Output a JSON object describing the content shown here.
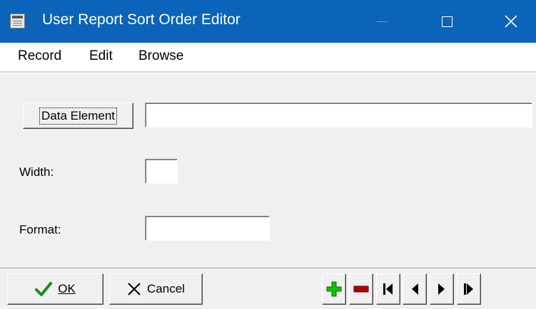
{
  "window": {
    "title": "User Report Sort Order Editor",
    "icons": {
      "app": "report-app-icon",
      "minimize": "minimize-icon",
      "maximize": "maximize-icon",
      "close": "close-icon"
    }
  },
  "menu": {
    "items": [
      "Record",
      "Edit",
      "Browse"
    ]
  },
  "form": {
    "data_element_button": "Data Element",
    "data_element_value": "",
    "width_label": "Width:",
    "width_value": "",
    "format_label": "Format:",
    "format_value": ""
  },
  "footer": {
    "ok_label": "OK",
    "cancel_label": "Cancel",
    "nav_icons": [
      "add-record-icon",
      "delete-record-icon",
      "first-record-icon",
      "previous-record-icon",
      "next-record-icon",
      "last-record-icon"
    ]
  },
  "colors": {
    "titlebar": "#0b63ba",
    "add": "#10c010",
    "delete": "#b00000",
    "ok_check": "#1a8a1a"
  }
}
